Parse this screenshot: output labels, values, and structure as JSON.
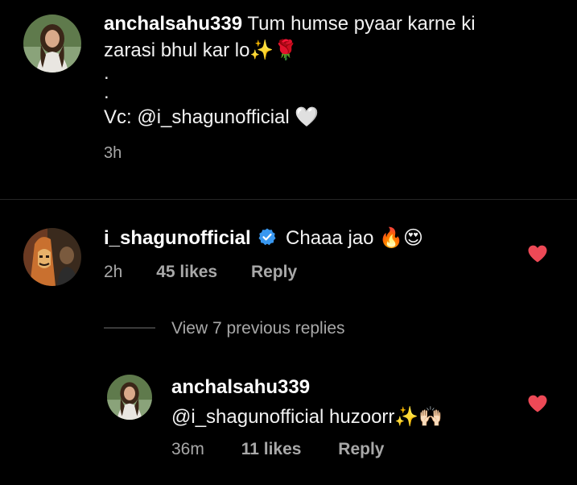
{
  "caption": {
    "username": "anchalsahu339",
    "text_line1": "Tum humse pyaar karne ki",
    "text_line2": "zarasi bhul kar lo",
    "line2_emojis": "✨🌹",
    "dot1": ".",
    "dot2": ".",
    "credit": "Vc: @i_shagunofficial",
    "credit_emoji": "🤍",
    "time": "3h"
  },
  "comment": {
    "username": "i_shagunofficial",
    "verified_icon": "verified-badge-icon",
    "text": "Chaaa jao",
    "emojis": "🔥😍",
    "time": "2h",
    "likes": "45 likes",
    "reply_label": "Reply",
    "liked": true
  },
  "view_replies": "View 7 previous replies",
  "reply": {
    "username": "anchalsahu339",
    "text": "@i_shagunofficial huzoorr",
    "emojis": "✨🙌🏻",
    "time": "36m",
    "likes": "11 likes",
    "reply_label": "Reply",
    "liked": true
  },
  "colors": {
    "background": "#000000",
    "primary_text": "#f2f2f2",
    "secondary_text": "#a8a8a8",
    "heart": "#ed4956",
    "verified": "#3897f0"
  }
}
